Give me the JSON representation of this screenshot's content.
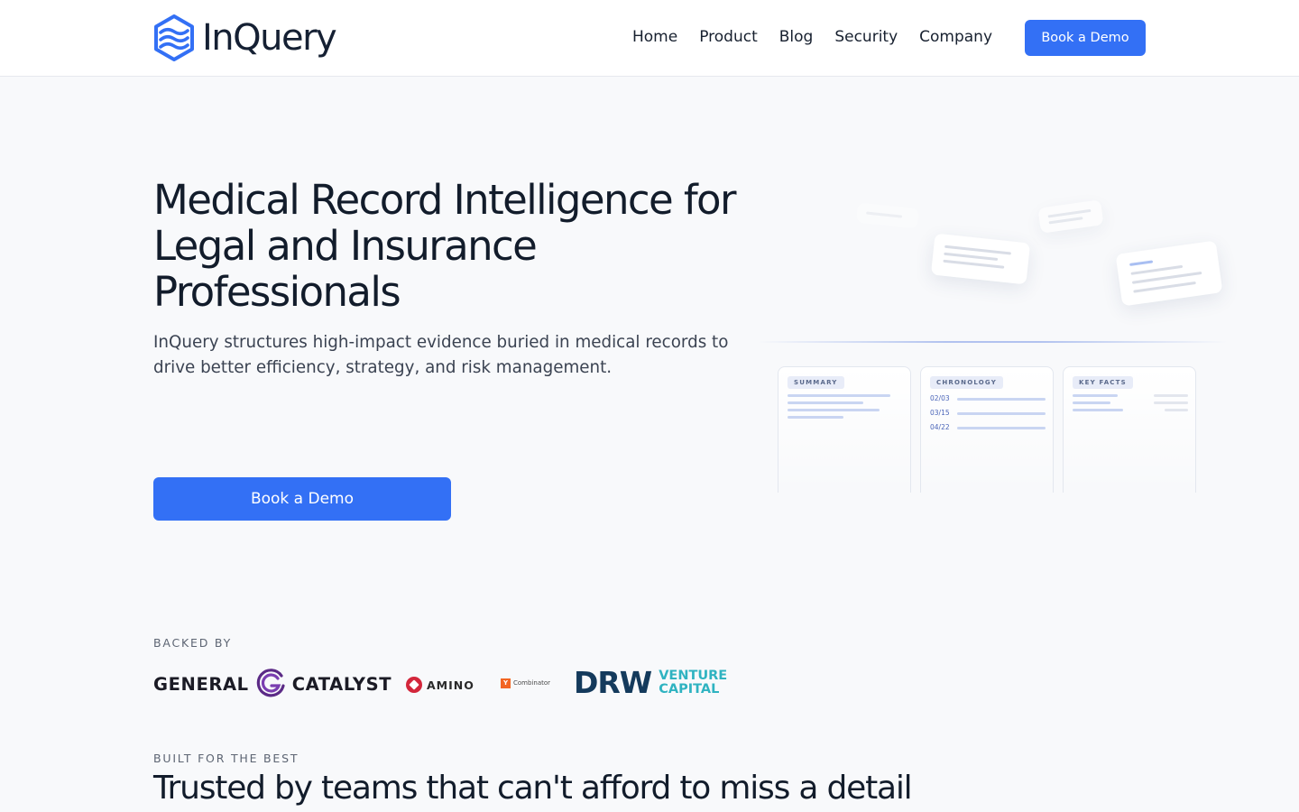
{
  "brand": {
    "name": "InQuery",
    "accent": "#3370f5"
  },
  "nav": {
    "items": [
      {
        "label": "Home"
      },
      {
        "label": "Product"
      },
      {
        "label": "Blog"
      },
      {
        "label": "Security"
      },
      {
        "label": "Company"
      }
    ],
    "cta_label": "Book a Demo"
  },
  "hero": {
    "title": "Medical Record Intelligence for Legal and Insurance Professionals",
    "subtitle": "InQuery structures high-impact evidence buried in medical records to drive better efficiency, strategy, and risk management.",
    "cta_label": "Book a Demo"
  },
  "illustration": {
    "panels": [
      {
        "tag": "SUMMARY"
      },
      {
        "tag": "CHRONOLOGY",
        "dates": [
          "02/03",
          "03/15",
          "04/22"
        ]
      },
      {
        "tag": "KEY FACTS"
      }
    ]
  },
  "backers": {
    "eyebrow": "BACKED BY",
    "logos": {
      "general_catalyst": {
        "left": "GENERAL",
        "right": "CATALYST"
      },
      "amino": "AMINO",
      "ycombinator": {
        "mark": "Y",
        "text": "Combinator"
      },
      "drw": {
        "mark": "DRW",
        "line1": "VENTURE",
        "line2": "CAPITAL"
      }
    }
  },
  "trusted": {
    "eyebrow": "BUILT FOR THE BEST",
    "heading": "Trusted by teams that can't afford to miss a detail"
  }
}
